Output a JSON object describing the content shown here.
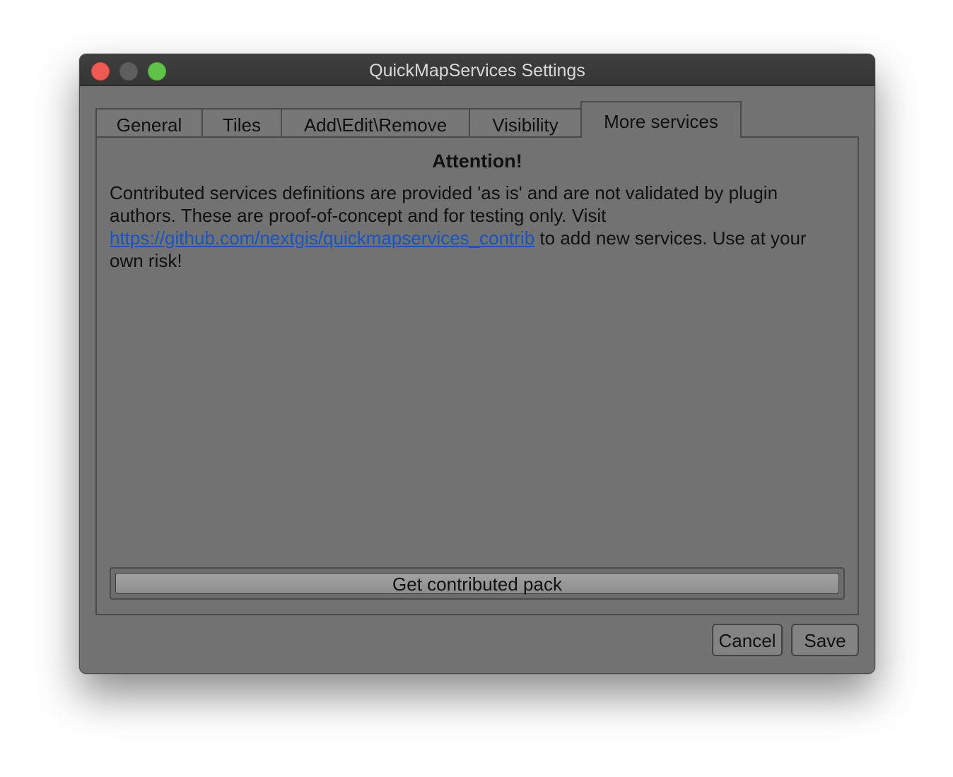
{
  "window": {
    "title": "QuickMapServices Settings"
  },
  "tabs": [
    {
      "label": "General"
    },
    {
      "label": "Tiles"
    },
    {
      "label": "Add\\Edit\\Remove"
    },
    {
      "label": "Visibility"
    },
    {
      "label": "More services",
      "active": true
    }
  ],
  "content": {
    "heading": "Attention!",
    "notice_before_link": "Contributed services definitions are provided 'as is' and are not validated by plugin authors. These are proof-of-concept and for testing only. Visit ",
    "link_text": "https://github.com/nextgis/quickmapservices_contrib",
    "notice_after_link": " to add new services. Use at your own risk!",
    "pack_button": "Get contributed pack"
  },
  "footer": {
    "cancel_label": "Cancel",
    "save_label": "Save"
  },
  "colors": {
    "window_bg": "#727272",
    "titlebar_bg": "#3a3a3a",
    "link": "#1654c9",
    "close": "#ee5a52",
    "minimize": "#5e5e5e",
    "maximize": "#5fc34a"
  }
}
